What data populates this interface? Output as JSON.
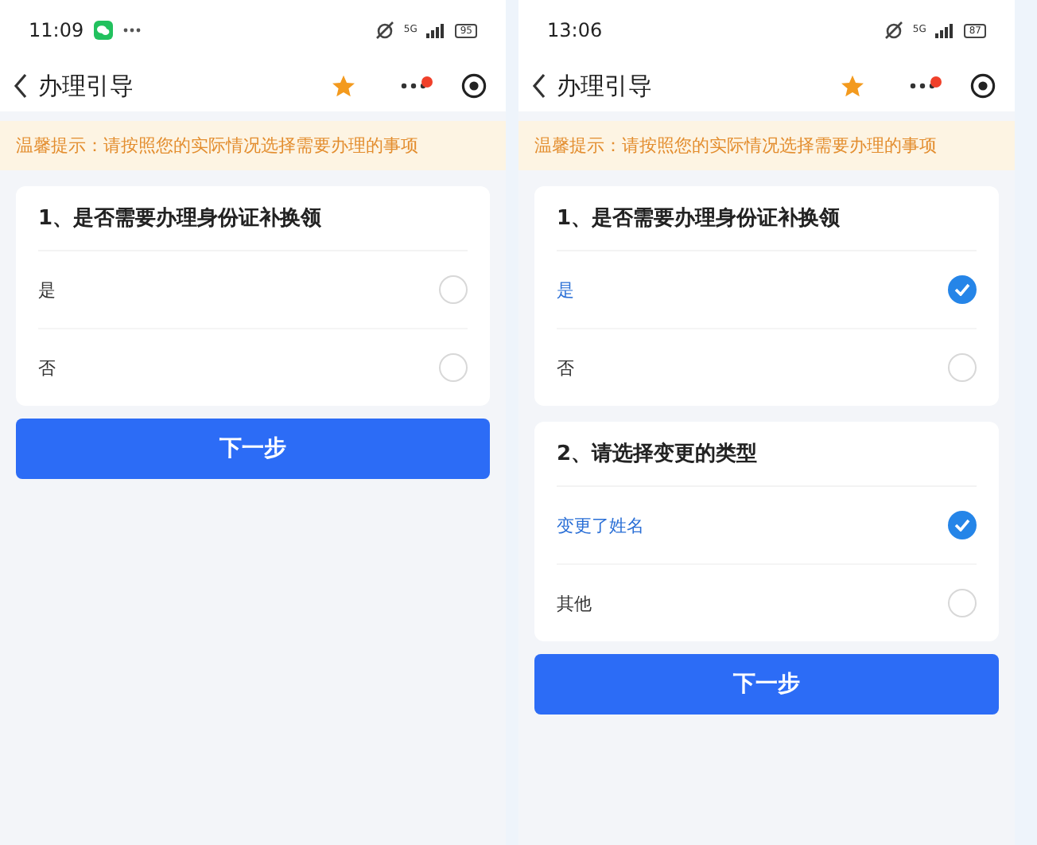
{
  "phones": [
    {
      "status": {
        "time": "11:09",
        "chat_notification": true,
        "network": "5G",
        "battery": "95"
      },
      "nav": {
        "title": "办理引导",
        "badge": true
      },
      "tip": "温馨提示：请按照您的实际情况选择需要办理的事项",
      "questions": [
        {
          "title": "1、是否需要办理身份证补换领",
          "options": [
            {
              "label": "是",
              "selected": false
            },
            {
              "label": "否",
              "selected": false
            }
          ]
        }
      ],
      "button": "下一步"
    },
    {
      "status": {
        "time": "13:06",
        "chat_notification": false,
        "network": "5G",
        "battery": "87"
      },
      "nav": {
        "title": "办理引导",
        "badge": true
      },
      "tip": "温馨提示：请按照您的实际情况选择需要办理的事项",
      "questions": [
        {
          "title": "1、是否需要办理身份证补换领",
          "options": [
            {
              "label": "是",
              "selected": true
            },
            {
              "label": "否",
              "selected": false
            }
          ]
        },
        {
          "title": "2、请选择变更的类型",
          "options": [
            {
              "label": "变更了姓名",
              "selected": true
            },
            {
              "label": "其他",
              "selected": false
            }
          ]
        }
      ],
      "button": "下一步"
    }
  ]
}
